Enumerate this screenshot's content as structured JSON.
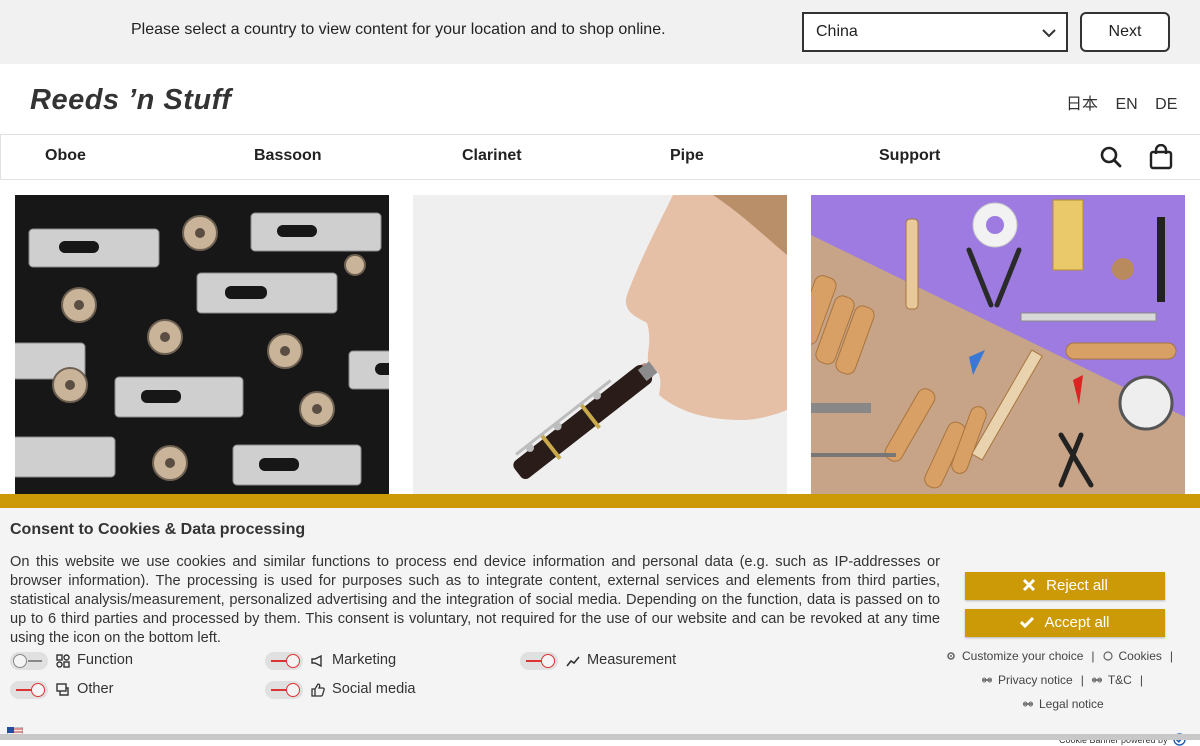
{
  "country_bar": {
    "message": "Please select a country to view content for your location and to shop online.",
    "selected_country": "China",
    "next_label": "Next"
  },
  "header": {
    "logo": "Reeds ’n Stuff",
    "languages": [
      "日本",
      "EN",
      "DE"
    ]
  },
  "nav": {
    "items": [
      "Oboe",
      "Bassoon",
      "Clarinet",
      "Pipe",
      "Support"
    ],
    "icons": [
      "search-icon",
      "shopping-bag-icon"
    ]
  },
  "tiles": [
    {
      "subject": "staples-on-black"
    },
    {
      "subject": "oboe-player"
    },
    {
      "subject": "reed-tools-on-purple"
    }
  ],
  "cookie_banner": {
    "accent_color": "#cc9a06",
    "title": "Consent to Cookies & Data processing",
    "text": "On this website we use cookies and similar functions to process end device information and personal data (e.g. such as IP-addresses or browser information). The processing is used for purposes such as to integrate content, external services and elements from third parties, statistical analysis/measurement, personalized advertising and the integration of social media. Depending on the function, data is passed on to up to 6 third parties and processed by them. This consent is voluntary, not required for the use of our website and can be revoked at any time using the icon on the bottom left.",
    "options": [
      {
        "label": "Function",
        "enabled": true,
        "icon": "function-icon"
      },
      {
        "label": "Marketing",
        "enabled": false,
        "icon": "megaphone-icon"
      },
      {
        "label": "Measurement",
        "enabled": false,
        "icon": "chart-icon"
      },
      {
        "label": "Other",
        "enabled": false,
        "icon": "chat-icon"
      },
      {
        "label": "Social media",
        "enabled": false,
        "icon": "thumbs-up-icon"
      }
    ],
    "reject_label": "Reject all",
    "accept_label": "Accept all",
    "links": {
      "customize": "Customize your choice",
      "cookies": "Cookies",
      "privacy": "Privacy notice",
      "tc": "T&C",
      "legal": "Legal notice"
    },
    "powered_by": "Cookie Banner powered by"
  }
}
